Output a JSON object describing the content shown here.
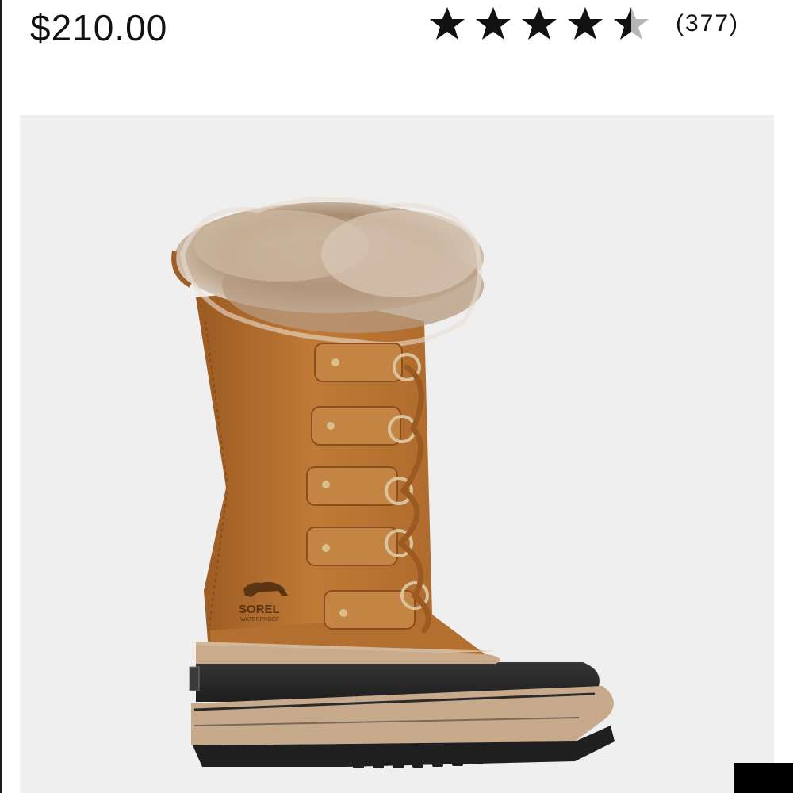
{
  "product": {
    "price": "$210.00",
    "rating": {
      "value": 4.5,
      "max": 5,
      "review_count_label": "(377)"
    },
    "image": {
      "icon": "boot-product-image",
      "brand_mark": "SOREL",
      "brand_sub": "WATERPROOF",
      "background_color": "#efefef"
    }
  },
  "colors": {
    "star_filled": "#111111",
    "star_empty": "#b5b5b5",
    "suede": "#b8712f",
    "rubber": "#2b2b2b"
  }
}
